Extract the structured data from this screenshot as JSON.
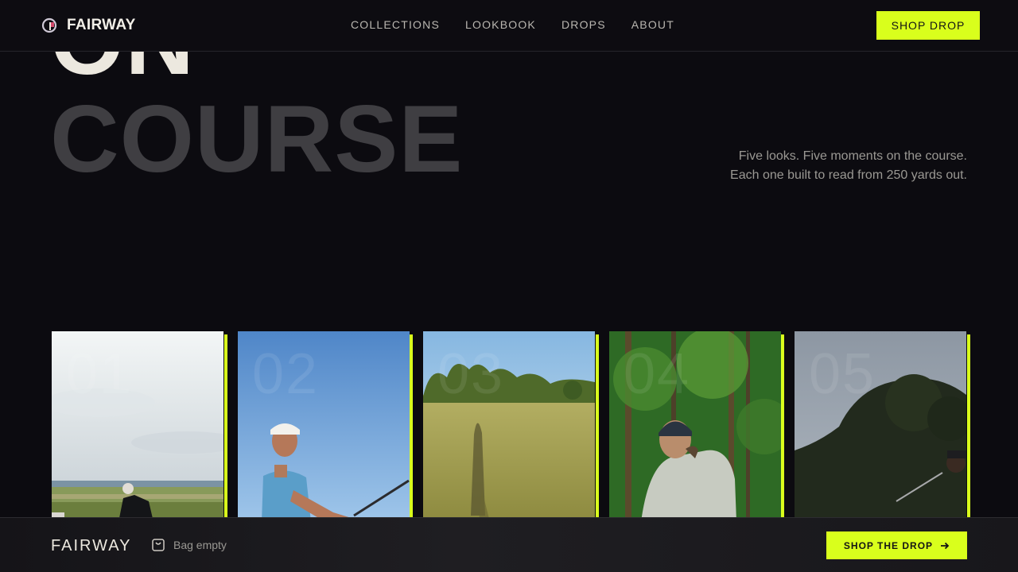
{
  "brand": {
    "name": "FAIRWAY",
    "logo_icon": "golf-flag-logo-icon"
  },
  "nav": {
    "links": [
      {
        "label": "COLLECTIONS"
      },
      {
        "label": "LOOKBOOK"
      },
      {
        "label": "DROPS"
      },
      {
        "label": "ABOUT"
      }
    ],
    "cta_label": "SHOP DROP"
  },
  "hero": {
    "line1": "ON",
    "line2": "COURSE",
    "subtitle_line1": "Five looks. Five moments on the course.",
    "subtitle_line2": "Each one built to read from 250 yards out."
  },
  "looks": [
    {
      "number": "01"
    },
    {
      "number": "02"
    },
    {
      "number": "03"
    },
    {
      "number": "04"
    },
    {
      "number": "05"
    }
  ],
  "bottom_bar": {
    "brand": "FAIRWAY",
    "bag_status": "Bag empty",
    "bag_icon": "shopping-bag-icon",
    "cta_label": "SHOP THE DROP",
    "cta_icon": "arrow-right-icon"
  },
  "colors": {
    "background": "#0c0b10",
    "accent": "#d9ff1c",
    "text_primary": "#ece8df",
    "text_muted": "#9a9893",
    "hero_dim": "#3f3e42"
  }
}
